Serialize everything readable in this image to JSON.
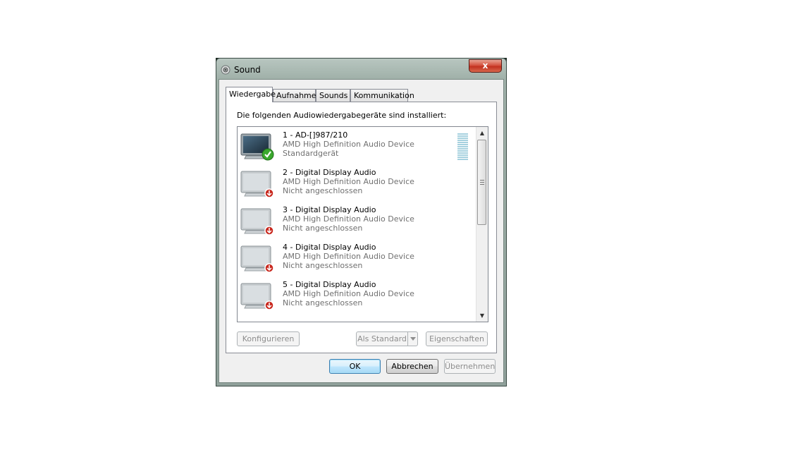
{
  "window": {
    "title": "Sound",
    "close_label": "x"
  },
  "tabs": [
    {
      "label": "Wiedergabe",
      "active": true
    },
    {
      "label": "Aufnahme",
      "active": false
    },
    {
      "label": "Sounds",
      "active": false
    },
    {
      "label": "Kommunikation",
      "active": false
    }
  ],
  "panel": {
    "intro": "Die folgenden Audiowiedergabegeräte sind installiert:"
  },
  "devices": [
    {
      "name": "1 - AD-[]987/210",
      "driver": "AMD High Definition Audio Device",
      "status": "Standardgerät",
      "state": "default"
    },
    {
      "name": "2 - Digital Display Audio",
      "driver": "AMD High Definition Audio Device",
      "status": "Nicht angeschlossen",
      "state": "unplugged"
    },
    {
      "name": "3 - Digital Display Audio",
      "driver": "AMD High Definition Audio Device",
      "status": "Nicht angeschlossen",
      "state": "unplugged"
    },
    {
      "name": "4 - Digital Display Audio",
      "driver": "AMD High Definition Audio Device",
      "status": "Nicht angeschlossen",
      "state": "unplugged"
    },
    {
      "name": "5 - Digital Display Audio",
      "driver": "AMD High Definition Audio Device",
      "status": "Nicht angeschlossen",
      "state": "unplugged"
    }
  ],
  "panel_buttons": {
    "configure": "Konfigurieren",
    "set_default": "Als Standard",
    "properties": "Eigenschaften"
  },
  "dialog_buttons": {
    "ok": "OK",
    "cancel": "Abbrechen",
    "apply": "Übernehmen"
  },
  "colors": {
    "default_check": "#3aa82d",
    "unplugged_badge": "#c8281e",
    "level_meter": "#a6d1df"
  }
}
